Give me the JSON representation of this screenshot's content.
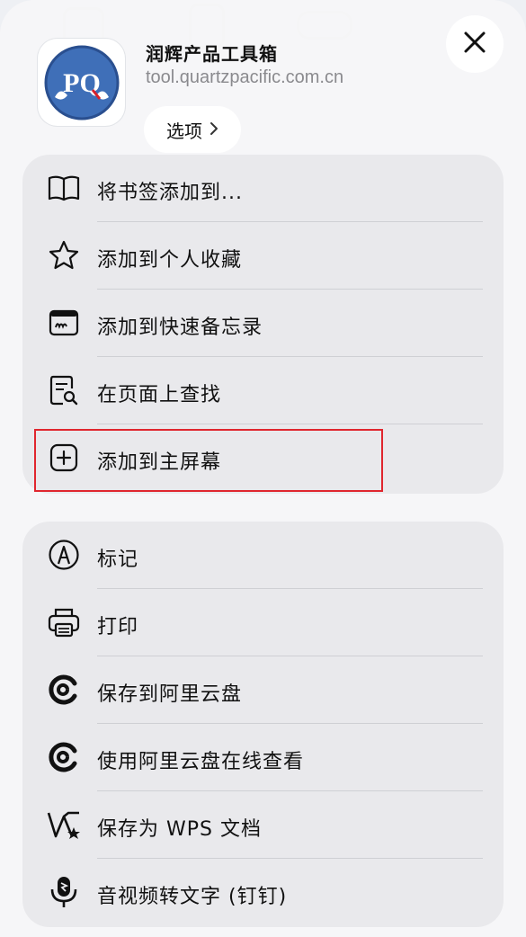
{
  "header": {
    "app_name": "润辉产品工具箱",
    "app_url": "tool.quartzpacific.com.cn",
    "options_label": "选项",
    "logo_text": "PQ"
  },
  "groups": [
    {
      "items": [
        {
          "label": "将书签添加到...",
          "icon": "book-icon"
        },
        {
          "label": "添加到个人收藏",
          "icon": "star-icon"
        },
        {
          "label": "添加到快速备忘录",
          "icon": "quick-note-icon"
        },
        {
          "label": "在页面上查找",
          "icon": "find-in-page-icon"
        },
        {
          "label": "添加到主屏幕",
          "icon": "plus-square-icon"
        }
      ]
    },
    {
      "items": [
        {
          "label": "标记",
          "icon": "markup-icon"
        },
        {
          "label": "打印",
          "icon": "printer-icon"
        },
        {
          "label": "保存到阿里云盘",
          "icon": "aliyun-drive-icon"
        },
        {
          "label": "使用阿里云盘在线查看",
          "icon": "aliyun-drive-icon"
        },
        {
          "label": "保存为 WPS 文档",
          "icon": "wps-icon"
        },
        {
          "label": "音视频转文字 (钉钉)",
          "icon": "dingtalk-mic-icon"
        }
      ]
    }
  ],
  "colors": {
    "highlight": "#e0262e",
    "logo_blue": "#3f6fb8"
  }
}
